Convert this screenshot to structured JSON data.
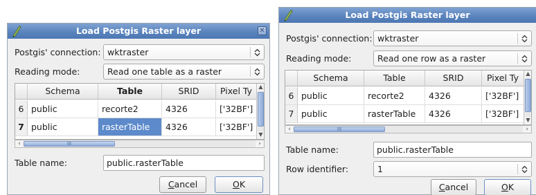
{
  "dialog_left": {
    "title": "Load Postgis Raster layer",
    "close_glyph": "✕",
    "connection_label": "Postgis' connection:",
    "connection_value": "wktraster",
    "mode_label": "Reading mode:",
    "mode_value": "Read one table as a raster",
    "columns": [
      "Schema",
      "Table",
      "SRID",
      "Pixel Ty"
    ],
    "rows": [
      {
        "num": "6",
        "schema": "public",
        "table": "recorte2",
        "srid": "4326",
        "pixel": "['32BF']"
      },
      {
        "num": "7",
        "schema": "public",
        "table": "rasterTable",
        "srid": "4326",
        "pixel": "['32BF']"
      }
    ],
    "hscroll_grip": "III",
    "table_name_label": "Table name:",
    "table_name_value": "public.rasterTable",
    "cancel_pre": "",
    "cancel_u": "C",
    "cancel_post": "ancel",
    "ok_pre": "",
    "ok_u": "O",
    "ok_post": "K"
  },
  "dialog_right": {
    "title": "Load Postgis Raster layer",
    "connection_label": "Postgis' connection:",
    "connection_value": "wktraster",
    "mode_label": "Reading mode:",
    "mode_value": "Read one row as a raster",
    "columns": [
      "Schema",
      "Table",
      "SRID",
      "Pixel Ty"
    ],
    "rows": [
      {
        "num": "6",
        "schema": "public",
        "table": "recorte2",
        "srid": "4326",
        "pixel": "['32BF']"
      },
      {
        "num": "7",
        "schema": "public",
        "table": "rasterTable",
        "srid": "4326",
        "pixel": "['32BF']"
      }
    ],
    "hscroll_grip": "III",
    "table_name_label": "Table name:",
    "table_name_value": "public.rasterTable",
    "row_id_label": "Row identifier:",
    "row_id_value": "1",
    "cancel_pre": "",
    "cancel_u": "C",
    "cancel_post": "ancel",
    "ok_pre": "",
    "ok_u": "O",
    "ok_post": "K"
  },
  "icons": {
    "app": "qgis-pencil-icon",
    "close": "close-icon",
    "combo_arrow": "updown-arrow-icon"
  },
  "colors": {
    "title_bar": "#5b84bd",
    "selection": "#5d8acb",
    "dialog_bg": "#efefef"
  }
}
